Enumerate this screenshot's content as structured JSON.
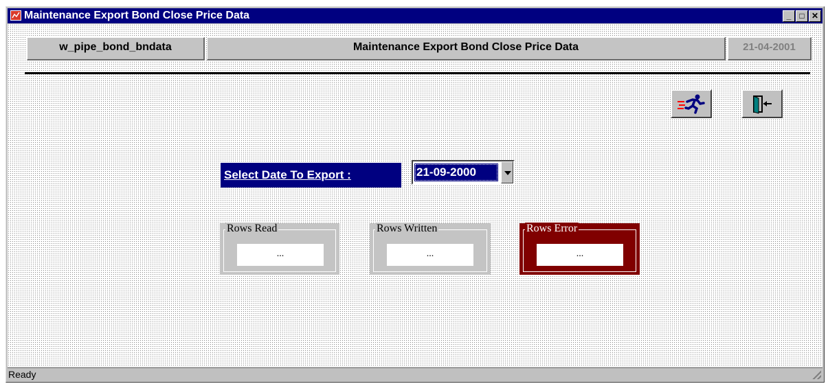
{
  "window": {
    "title": "Maintenance Export Bond Close Price Data",
    "minimize_symbol": "_",
    "maximize_symbol": "□",
    "close_symbol": "✕"
  },
  "header": {
    "window_name": "w_pipe_bond_bndata",
    "caption": "Maintenance Export Bond Close Price Data",
    "date": "21-04-2001"
  },
  "toolbar": {
    "run_icon": "running-man-icon",
    "exit_icon": "exit-door-icon"
  },
  "export": {
    "label": "Select Date To Export :",
    "selected_date": "21-09-2000"
  },
  "counters": {
    "rows_read": {
      "label": "Rows Read",
      "value": "..."
    },
    "rows_written": {
      "label": "Rows Written",
      "value": "..."
    },
    "rows_error": {
      "label": "Rows Error",
      "value": "..."
    }
  },
  "status": {
    "text": "Ready"
  },
  "colors": {
    "title_bar": "#000080",
    "error_group": "#800000",
    "face": "#c0c0c0"
  }
}
